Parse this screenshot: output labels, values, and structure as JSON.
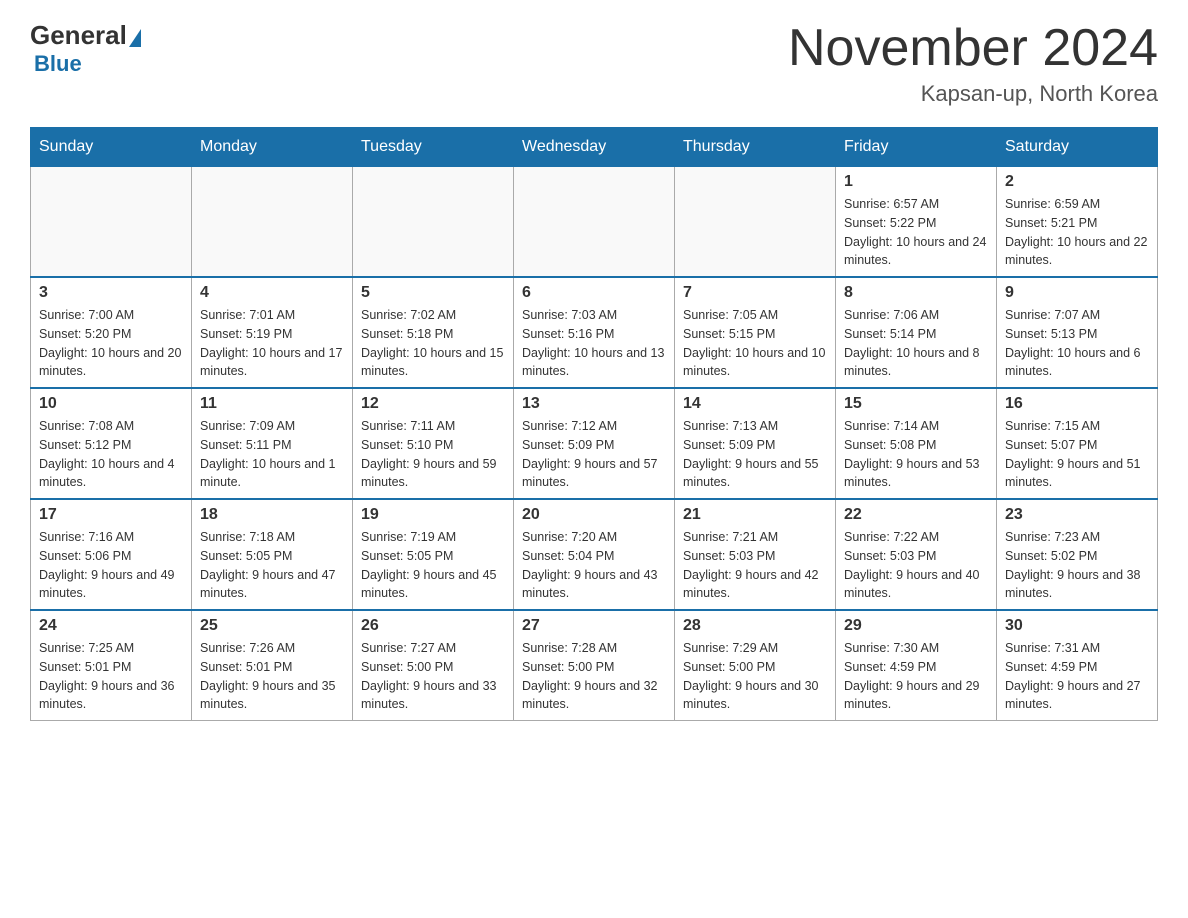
{
  "header": {
    "logo_general": "General",
    "logo_blue": "Blue",
    "month_title": "November 2024",
    "location": "Kapsan-up, North Korea"
  },
  "days_of_week": [
    "Sunday",
    "Monday",
    "Tuesday",
    "Wednesday",
    "Thursday",
    "Friday",
    "Saturday"
  ],
  "weeks": [
    [
      {
        "day": "",
        "info": ""
      },
      {
        "day": "",
        "info": ""
      },
      {
        "day": "",
        "info": ""
      },
      {
        "day": "",
        "info": ""
      },
      {
        "day": "",
        "info": ""
      },
      {
        "day": "1",
        "info": "Sunrise: 6:57 AM\nSunset: 5:22 PM\nDaylight: 10 hours and 24 minutes."
      },
      {
        "day": "2",
        "info": "Sunrise: 6:59 AM\nSunset: 5:21 PM\nDaylight: 10 hours and 22 minutes."
      }
    ],
    [
      {
        "day": "3",
        "info": "Sunrise: 7:00 AM\nSunset: 5:20 PM\nDaylight: 10 hours and 20 minutes."
      },
      {
        "day": "4",
        "info": "Sunrise: 7:01 AM\nSunset: 5:19 PM\nDaylight: 10 hours and 17 minutes."
      },
      {
        "day": "5",
        "info": "Sunrise: 7:02 AM\nSunset: 5:18 PM\nDaylight: 10 hours and 15 minutes."
      },
      {
        "day": "6",
        "info": "Sunrise: 7:03 AM\nSunset: 5:16 PM\nDaylight: 10 hours and 13 minutes."
      },
      {
        "day": "7",
        "info": "Sunrise: 7:05 AM\nSunset: 5:15 PM\nDaylight: 10 hours and 10 minutes."
      },
      {
        "day": "8",
        "info": "Sunrise: 7:06 AM\nSunset: 5:14 PM\nDaylight: 10 hours and 8 minutes."
      },
      {
        "day": "9",
        "info": "Sunrise: 7:07 AM\nSunset: 5:13 PM\nDaylight: 10 hours and 6 minutes."
      }
    ],
    [
      {
        "day": "10",
        "info": "Sunrise: 7:08 AM\nSunset: 5:12 PM\nDaylight: 10 hours and 4 minutes."
      },
      {
        "day": "11",
        "info": "Sunrise: 7:09 AM\nSunset: 5:11 PM\nDaylight: 10 hours and 1 minute."
      },
      {
        "day": "12",
        "info": "Sunrise: 7:11 AM\nSunset: 5:10 PM\nDaylight: 9 hours and 59 minutes."
      },
      {
        "day": "13",
        "info": "Sunrise: 7:12 AM\nSunset: 5:09 PM\nDaylight: 9 hours and 57 minutes."
      },
      {
        "day": "14",
        "info": "Sunrise: 7:13 AM\nSunset: 5:09 PM\nDaylight: 9 hours and 55 minutes."
      },
      {
        "day": "15",
        "info": "Sunrise: 7:14 AM\nSunset: 5:08 PM\nDaylight: 9 hours and 53 minutes."
      },
      {
        "day": "16",
        "info": "Sunrise: 7:15 AM\nSunset: 5:07 PM\nDaylight: 9 hours and 51 minutes."
      }
    ],
    [
      {
        "day": "17",
        "info": "Sunrise: 7:16 AM\nSunset: 5:06 PM\nDaylight: 9 hours and 49 minutes."
      },
      {
        "day": "18",
        "info": "Sunrise: 7:18 AM\nSunset: 5:05 PM\nDaylight: 9 hours and 47 minutes."
      },
      {
        "day": "19",
        "info": "Sunrise: 7:19 AM\nSunset: 5:05 PM\nDaylight: 9 hours and 45 minutes."
      },
      {
        "day": "20",
        "info": "Sunrise: 7:20 AM\nSunset: 5:04 PM\nDaylight: 9 hours and 43 minutes."
      },
      {
        "day": "21",
        "info": "Sunrise: 7:21 AM\nSunset: 5:03 PM\nDaylight: 9 hours and 42 minutes."
      },
      {
        "day": "22",
        "info": "Sunrise: 7:22 AM\nSunset: 5:03 PM\nDaylight: 9 hours and 40 minutes."
      },
      {
        "day": "23",
        "info": "Sunrise: 7:23 AM\nSunset: 5:02 PM\nDaylight: 9 hours and 38 minutes."
      }
    ],
    [
      {
        "day": "24",
        "info": "Sunrise: 7:25 AM\nSunset: 5:01 PM\nDaylight: 9 hours and 36 minutes."
      },
      {
        "day": "25",
        "info": "Sunrise: 7:26 AM\nSunset: 5:01 PM\nDaylight: 9 hours and 35 minutes."
      },
      {
        "day": "26",
        "info": "Sunrise: 7:27 AM\nSunset: 5:00 PM\nDaylight: 9 hours and 33 minutes."
      },
      {
        "day": "27",
        "info": "Sunrise: 7:28 AM\nSunset: 5:00 PM\nDaylight: 9 hours and 32 minutes."
      },
      {
        "day": "28",
        "info": "Sunrise: 7:29 AM\nSunset: 5:00 PM\nDaylight: 9 hours and 30 minutes."
      },
      {
        "day": "29",
        "info": "Sunrise: 7:30 AM\nSunset: 4:59 PM\nDaylight: 9 hours and 29 minutes."
      },
      {
        "day": "30",
        "info": "Sunrise: 7:31 AM\nSunset: 4:59 PM\nDaylight: 9 hours and 27 minutes."
      }
    ]
  ]
}
